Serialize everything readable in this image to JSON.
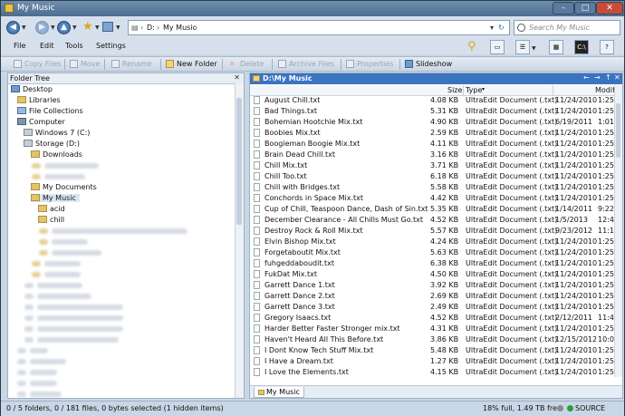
{
  "window": {
    "title": "My Music"
  },
  "nav": {
    "back_icon": "back-arrow-icon",
    "forward_icon": "forward-arrow-icon",
    "address_path": [
      "D:",
      "My Music"
    ],
    "search_placeholder": "Search My Music"
  },
  "menu": {
    "items": [
      "File",
      "Edit",
      "Tools",
      "Settings"
    ]
  },
  "toolbar": {
    "copy_files": "Copy Files",
    "move": "Move",
    "rename": "Rename",
    "new_folder": "New Folder",
    "delete": "Delete",
    "archive_files": "Archive Files",
    "properties": "Properties",
    "slideshow": "Slideshow"
  },
  "tree": {
    "title": "Folder Tree",
    "nodes": {
      "desktop": "Desktop",
      "libraries": "Libraries",
      "file_collections": "File Collections",
      "computer": "Computer",
      "windows7": "Windows 7 (C:)",
      "storage": "Storage (D:)",
      "downloads": "Downloads",
      "my_documents": "My Documents",
      "my_music": "My Music",
      "acid": "acid",
      "chill": "chill"
    }
  },
  "pane": {
    "path": "D:\\My Music",
    "columns": {
      "name": "",
      "size": "Size",
      "type": "Type",
      "date": "Modif"
    },
    "files": [
      {
        "name": "August Chill.txt",
        "size": "4.08 KB",
        "type": "UltraEdit Document (.txt)",
        "date": "11/24/2010",
        "time": "1:25"
      },
      {
        "name": "Bad Things.txt",
        "size": "5.31 KB",
        "type": "UltraEdit Document (.txt)",
        "date": "11/24/2010",
        "time": "1:25"
      },
      {
        "name": "Bohemian Hootchie Mix.txt",
        "size": "4.90 KB",
        "type": "UltraEdit Document (.txt)",
        "date": "6/19/2011",
        "time": "1:01"
      },
      {
        "name": "Boobies Mix.txt",
        "size": "2.59 KB",
        "type": "UltraEdit Document (.txt)",
        "date": "11/24/2010",
        "time": "1:25"
      },
      {
        "name": "Boogieman Boogie Mix.txt",
        "size": "4.11 KB",
        "type": "UltraEdit Document (.txt)",
        "date": "11/24/2010",
        "time": "1:25"
      },
      {
        "name": "Brain Dead Chill.txt",
        "size": "3.16 KB",
        "type": "UltraEdit Document (.txt)",
        "date": "11/24/2010",
        "time": "1:25"
      },
      {
        "name": "Chill Mix.txt",
        "size": "3.71 KB",
        "type": "UltraEdit Document (.txt)",
        "date": "11/24/2010",
        "time": "1:25"
      },
      {
        "name": "Chill Too.txt",
        "size": "6.18 KB",
        "type": "UltraEdit Document (.txt)",
        "date": "11/24/2010",
        "time": "1:25"
      },
      {
        "name": "Chill with Bridges.txt",
        "size": "5.58 KB",
        "type": "UltraEdit Document (.txt)",
        "date": "11/24/2010",
        "time": "1:25"
      },
      {
        "name": "Conchords in Space Mix.txt",
        "size": "4.42 KB",
        "type": "UltraEdit Document (.txt)",
        "date": "11/24/2010",
        "time": "1:25"
      },
      {
        "name": "Cup of Chill, Teaspoon Dance, Dash of Sin.txt",
        "size": "5.35 KB",
        "type": "UltraEdit Document (.txt)",
        "date": "1/14/2011",
        "time": "9:22"
      },
      {
        "name": "December Clearance - All Chills Must Go.txt",
        "size": "4.52 KB",
        "type": "UltraEdit Document (.txt)",
        "date": "1/5/2013",
        "time": "12:42"
      },
      {
        "name": "Destroy Rock & Roll Mix.txt",
        "size": "5.57 KB",
        "type": "UltraEdit Document (.txt)",
        "date": "9/23/2012",
        "time": "11:13"
      },
      {
        "name": "Elvin Bishop Mix.txt",
        "size": "4.24 KB",
        "type": "UltraEdit Document (.txt)",
        "date": "11/24/2010",
        "time": "1:25"
      },
      {
        "name": "Forgetaboutit Mix.txt",
        "size": "5.63 KB",
        "type": "UltraEdit Document (.txt)",
        "date": "11/24/2010",
        "time": "1:25"
      },
      {
        "name": "fuhgeddaboudit.txt",
        "size": "6.38 KB",
        "type": "UltraEdit Document (.txt)",
        "date": "11/24/2010",
        "time": "1:25"
      },
      {
        "name": "FukDat Mix.txt",
        "size": "4.50 KB",
        "type": "UltraEdit Document (.txt)",
        "date": "11/24/2010",
        "time": "1:25"
      },
      {
        "name": "Garrett Dance 1.txt",
        "size": "3.92 KB",
        "type": "UltraEdit Document (.txt)",
        "date": "11/24/2010",
        "time": "1:25"
      },
      {
        "name": "Garrett Dance 2.txt",
        "size": "2.69 KB",
        "type": "UltraEdit Document (.txt)",
        "date": "11/24/2010",
        "time": "1:25"
      },
      {
        "name": "Garrett Dance 3.txt",
        "size": "2.49 KB",
        "type": "UltraEdit Document (.txt)",
        "date": "11/24/2010",
        "time": "1:25"
      },
      {
        "name": "Gregory Isaacs.txt",
        "size": "4.52 KB",
        "type": "UltraEdit Document (.txt)",
        "date": "2/12/2011",
        "time": "11:48"
      },
      {
        "name": "Harder Better Faster Stronger mix.txt",
        "size": "4.31 KB",
        "type": "UltraEdit Document (.txt)",
        "date": "11/24/2010",
        "time": "1:25"
      },
      {
        "name": "Haven't Heard All This Before.txt",
        "size": "3.86 KB",
        "type": "UltraEdit Document (.txt)",
        "date": "12/15/2012",
        "time": "10:04"
      },
      {
        "name": "I Dont Know Tech Stuff Mix.txt",
        "size": "5.48 KB",
        "type": "UltraEdit Document (.txt)",
        "date": "11/24/2010",
        "time": "1:25"
      },
      {
        "name": "I Have a Dream.txt",
        "size": "1.27 KB",
        "type": "UltraEdit Document (.txt)",
        "date": "11/24/2010",
        "time": "1:25"
      },
      {
        "name": "I Love the Elements.txt",
        "size": "4.15 KB",
        "type": "UltraEdit Document (.txt)",
        "date": "11/24/2010",
        "time": "1:25"
      }
    ],
    "tab_label": "My Music"
  },
  "status": {
    "selection": "0 / 5 folders, 0 / 181 files, 0 bytes selected (1 hidden items)",
    "disk": "18% full, 1.49 TB free",
    "source": "SOURCE"
  }
}
